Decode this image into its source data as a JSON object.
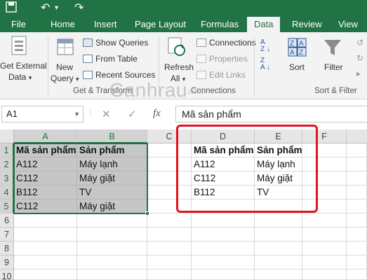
{
  "ribbon_tabs": [
    "File",
    "Home",
    "Insert",
    "Page Layout",
    "Formulas",
    "Data",
    "Review",
    "View"
  ],
  "active_tab": "Data",
  "ribbon": {
    "get_external_data": [
      "Get External",
      "Data"
    ],
    "new_query": [
      "New",
      "Query"
    ],
    "show_queries": "Show Queries",
    "from_table": "From Table",
    "recent_sources": "Recent Sources",
    "group_get_transform": "Get & Transform",
    "refresh_all": [
      "Refresh",
      "All"
    ],
    "connections": "Connections",
    "properties": "Properties",
    "edit_links": "Edit Links",
    "group_connections": "Connections",
    "sort": "Sort",
    "filter": "Filter",
    "group_sort_filter": "Sort & Filter"
  },
  "formula_bar": {
    "name_box": "A1",
    "formula": "Mã sản phẩm"
  },
  "columns": [
    "A",
    "B",
    "C",
    "D",
    "E",
    "F"
  ],
  "rows": [
    "1",
    "2",
    "3",
    "4",
    "5",
    "6",
    "7",
    "8",
    "9",
    "10"
  ],
  "table_ab": [
    [
      "Mã sản phẩm",
      "Sản phẩm"
    ],
    [
      "A112",
      "Máy lạnh"
    ],
    [
      "C112",
      "Máy giặt"
    ],
    [
      "B112",
      "TV"
    ],
    [
      "C112",
      "Máy giặt"
    ]
  ],
  "table_de": [
    [
      "Mã sản phẩm",
      "Sản phẩm"
    ],
    [
      "A112",
      "Máy lạnh"
    ],
    [
      "C112",
      "Máy giặt"
    ],
    [
      "B112",
      "TV"
    ]
  ],
  "watermark": "Canhrau.com",
  "colors": {
    "excel_green": "#217346",
    "highlight_red": "#e0141e",
    "selection_fill": "#c6c6c6"
  }
}
